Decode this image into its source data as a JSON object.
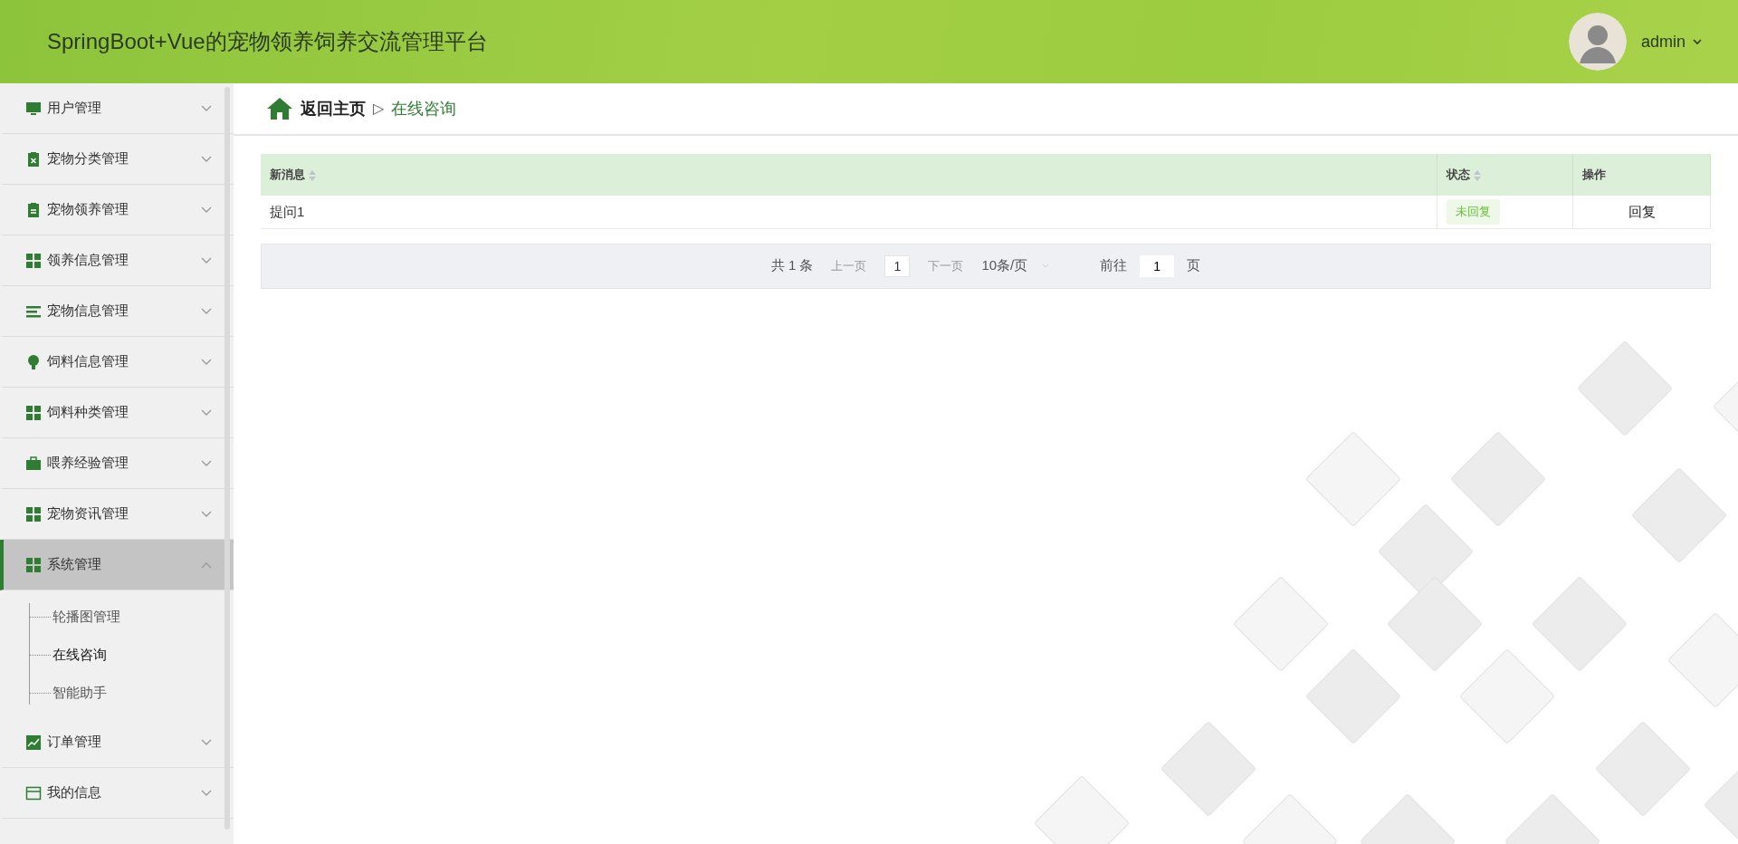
{
  "header": {
    "title": "SpringBoot+Vue的宠物领养饲养交流管理平台",
    "user": "admin"
  },
  "sidebar": {
    "items": [
      {
        "label": "用户管理",
        "expanded": false
      },
      {
        "label": "宠物分类管理",
        "expanded": false
      },
      {
        "label": "宠物领养管理",
        "expanded": false
      },
      {
        "label": "领养信息管理",
        "expanded": false
      },
      {
        "label": "宠物信息管理",
        "expanded": false
      },
      {
        "label": "饲料信息管理",
        "expanded": false
      },
      {
        "label": "饲料种类管理",
        "expanded": false
      },
      {
        "label": "喂养经验管理",
        "expanded": false
      },
      {
        "label": "宠物资讯管理",
        "expanded": false
      },
      {
        "label": "系统管理",
        "expanded": true,
        "children": [
          {
            "label": "轮播图管理",
            "selected": false
          },
          {
            "label": "在线咨询",
            "selected": true
          },
          {
            "label": "智能助手",
            "selected": false
          }
        ]
      },
      {
        "label": "订单管理",
        "expanded": false
      },
      {
        "label": "我的信息",
        "expanded": false
      }
    ]
  },
  "breadcrumb": {
    "home": "返回主页",
    "separator": "▷",
    "current": "在线咨询"
  },
  "table": {
    "columns": [
      {
        "label": "新消息",
        "sortable": true
      },
      {
        "label": "状态",
        "sortable": true
      },
      {
        "label": "操作",
        "sortable": false
      }
    ],
    "rows": [
      {
        "message": "提问1",
        "status": "未回复",
        "action": "回复"
      }
    ]
  },
  "pagination": {
    "total": "共 1 条",
    "prev": "上一页",
    "page": "1",
    "next": "下一页",
    "size": "10条/页",
    "goto": "前往",
    "goto_value": "1",
    "suffix": "页"
  }
}
